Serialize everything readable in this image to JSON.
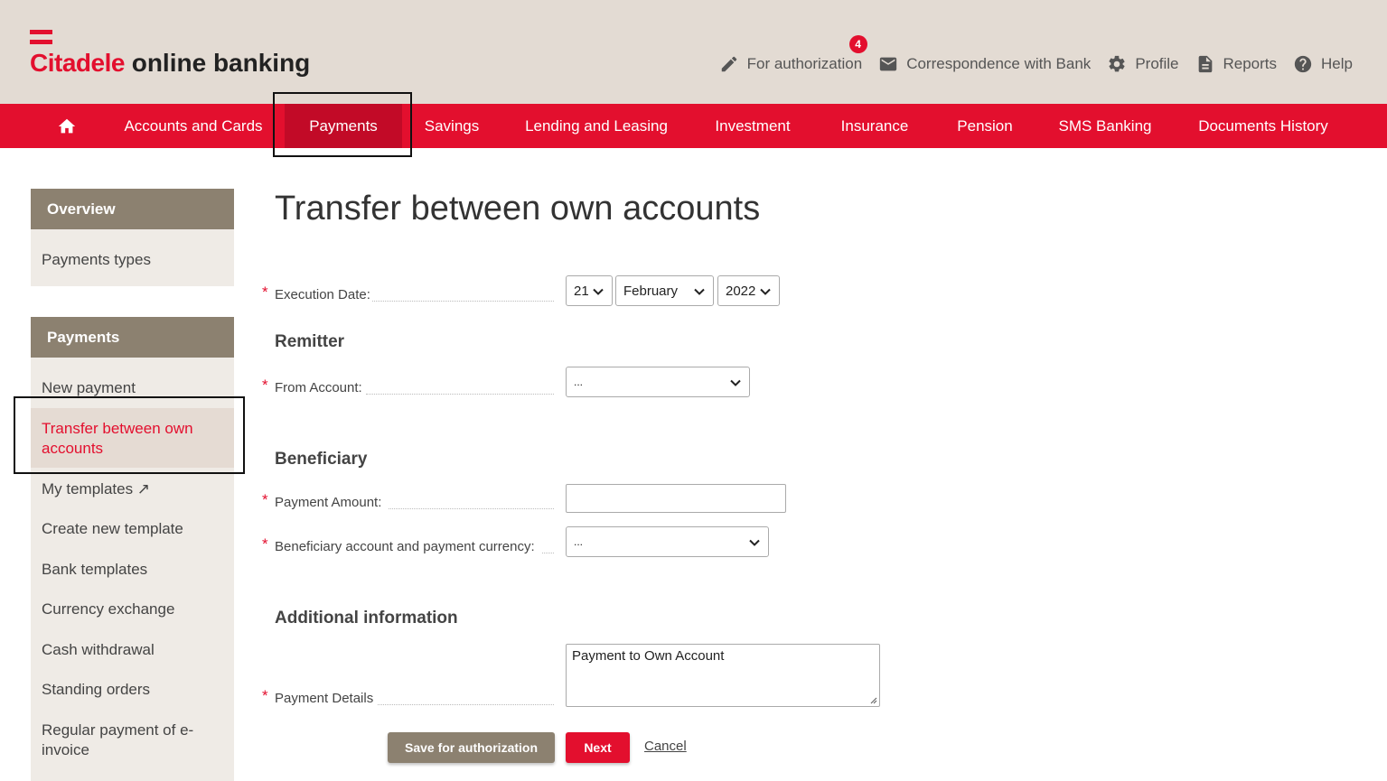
{
  "brand": {
    "name": "Citadele",
    "product": "online banking",
    "color": "#e30f2e"
  },
  "top_links": [
    {
      "label": "For authorization",
      "icon": "pencil-icon",
      "badge": "4"
    },
    {
      "label": "Correspondence with Bank",
      "icon": "envelope-icon"
    },
    {
      "label": "Profile",
      "icon": "gear-icon"
    },
    {
      "label": "Reports",
      "icon": "document-icon"
    },
    {
      "label": "Help",
      "icon": "help-icon"
    }
  ],
  "nav": {
    "home_icon": "home-icon",
    "items": [
      "Accounts and Cards",
      "Payments",
      "Savings",
      "Lending and Leasing",
      "Investment",
      "Insurance",
      "Pension",
      "SMS Banking",
      "Documents History"
    ],
    "active": "Payments"
  },
  "sidebar": {
    "overview": {
      "title": "Overview",
      "items": [
        "Payments types"
      ]
    },
    "payments": {
      "title": "Payments",
      "items": [
        "New payment",
        "Transfer between own accounts",
        "My templates ↗",
        "Create new template",
        "Bank templates",
        "Currency exchange",
        "Cash withdrawal",
        "Standing orders",
        "Regular payment of e-invoice"
      ],
      "active": "Transfer between own accounts"
    }
  },
  "form": {
    "title": "Transfer between own accounts",
    "required_mark": "*",
    "execution_date": {
      "label": "Execution Date:",
      "day": "21",
      "month": "February",
      "year": "2022"
    },
    "remitter": {
      "title": "Remitter",
      "from_account_label": "From Account:",
      "from_account_value": "..."
    },
    "beneficiary": {
      "title": "Beneficiary",
      "amount_label": "Payment Amount:",
      "amount_value": "",
      "account_currency_label": "Beneficiary account and payment currency:",
      "account_currency_value": "..."
    },
    "additional": {
      "title": "Additional information",
      "details_label": "Payment Details",
      "details_value": "Payment to Own Account"
    },
    "buttons": {
      "save": "Save for authorization",
      "next": "Next",
      "cancel": "Cancel"
    }
  }
}
